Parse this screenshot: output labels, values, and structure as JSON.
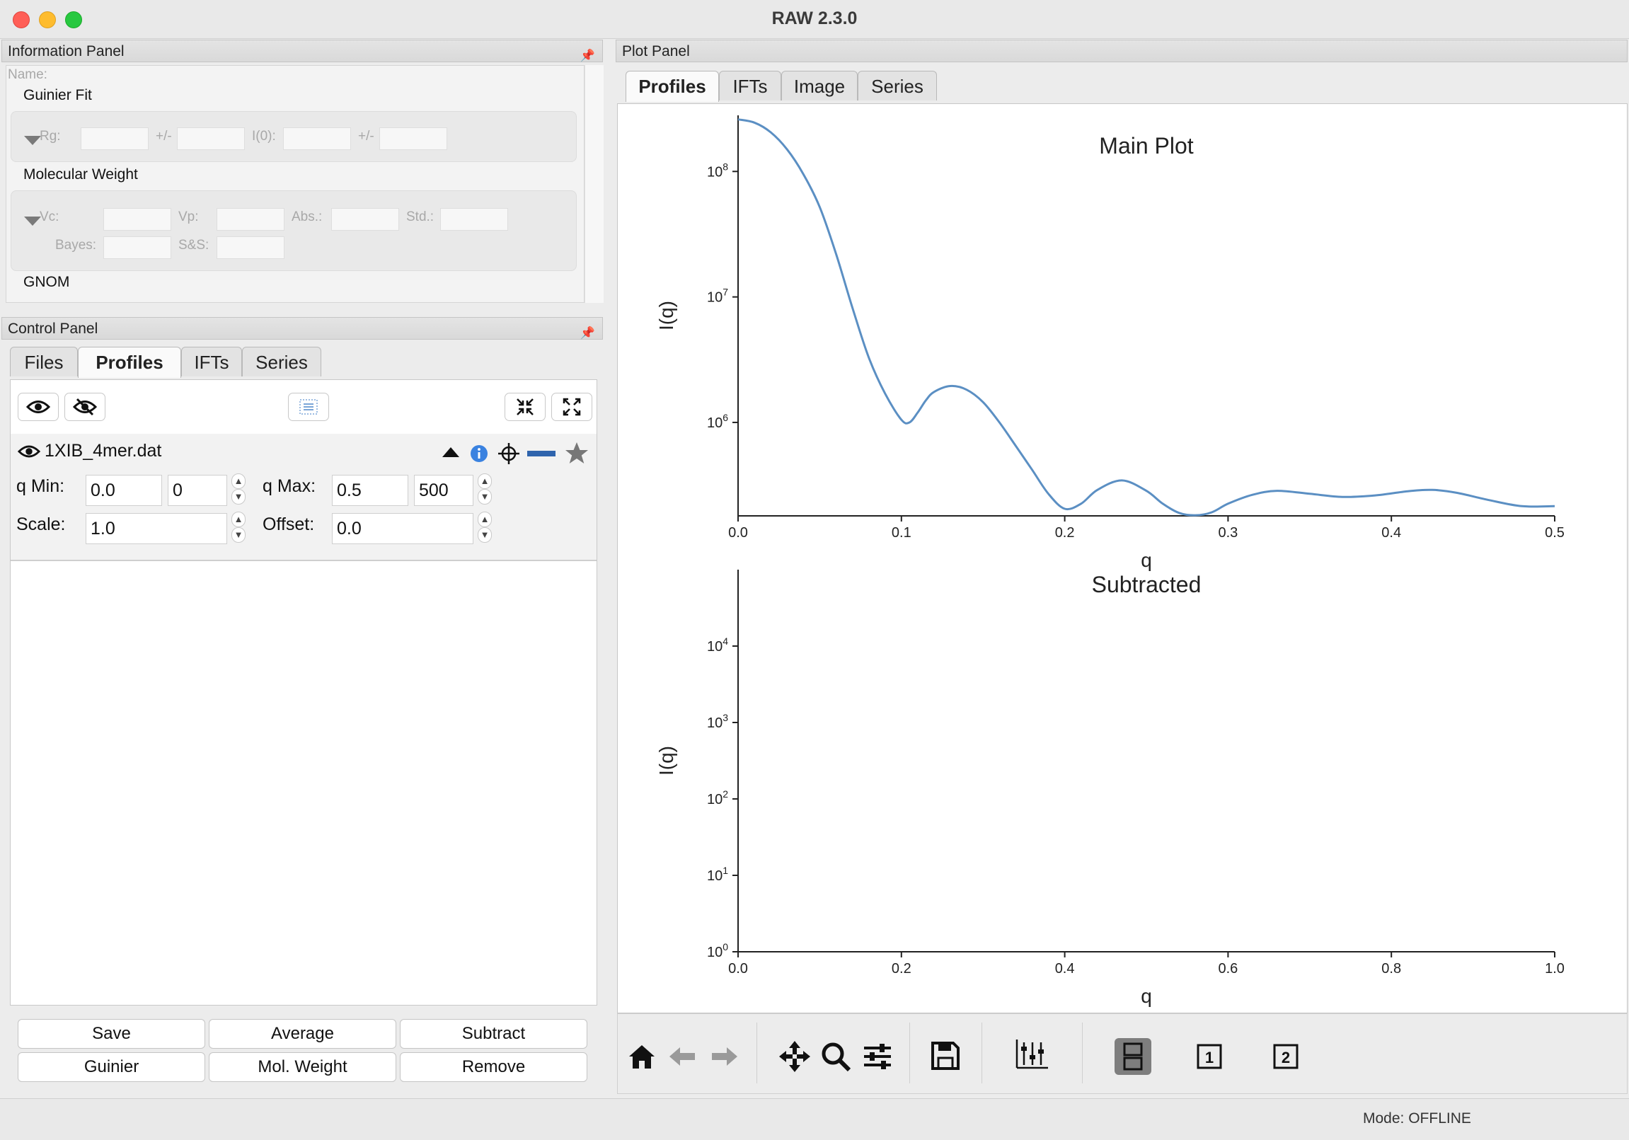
{
  "window": {
    "title": "RAW 2.3.0"
  },
  "info_panel": {
    "header": "Information Panel",
    "name_label": "Name:",
    "guinier": {
      "title": "Guinier Fit",
      "rg_label": "Rg:",
      "pm1": "+/-",
      "i0_label": "I(0):",
      "pm2": "+/-"
    },
    "mw": {
      "title": "Molecular Weight",
      "vc": "Vc:",
      "vp": "Vp:",
      "abs": "Abs.:",
      "std": "Std.:",
      "bayes": "Bayes:",
      "ss": "S&S:"
    },
    "gnom_title": "GNOM"
  },
  "control_panel": {
    "header": "Control Panel",
    "tabs": [
      "Files",
      "Profiles",
      "IFTs",
      "Series"
    ],
    "active_tab": "Profiles",
    "profile": {
      "filename": "1XIB_4mer.dat",
      "qmin_label": "q Min:",
      "qmin_value": "0.0",
      "qmin_index": "0",
      "qmax_label": "q Max:",
      "qmax_value": "0.5",
      "qmax_index": "500",
      "scale_label": "Scale:",
      "scale_value": "1.0",
      "offset_label": "Offset:",
      "offset_value": "0.0",
      "line_color": "#2f64ad"
    },
    "buttons": {
      "save": "Save",
      "average": "Average",
      "subtract": "Subtract",
      "guinier": "Guinier",
      "mol_weight": "Mol. Weight",
      "remove": "Remove"
    }
  },
  "plot_panel": {
    "header": "Plot Panel",
    "tabs": [
      "Profiles",
      "IFTs",
      "Image",
      "Series"
    ],
    "active_tab": "Profiles"
  },
  "chart_data": [
    {
      "type": "line",
      "title": "Main Plot",
      "xlabel": "q",
      "ylabel": "I(q)",
      "yscale": "log",
      "xlim": [
        0.0,
        0.5
      ],
      "ylim": [
        180000,
        280000000
      ],
      "xticks": [
        "0.0",
        "0.1",
        "0.2",
        "0.3",
        "0.4",
        "0.5"
      ],
      "yticks": [
        {
          "base": "10",
          "exp": "8",
          "value": 100000000
        },
        {
          "base": "10",
          "exp": "7",
          "value": 10000000
        },
        {
          "base": "10",
          "exp": "6",
          "value": 1000000
        }
      ],
      "color": "#5b8fc3",
      "series": [
        {
          "x": [
            0.0,
            0.01,
            0.02,
            0.03,
            0.04,
            0.05,
            0.06,
            0.07,
            0.08,
            0.09,
            0.1,
            0.105,
            0.11,
            0.115,
            0.12,
            0.13,
            0.14,
            0.15,
            0.16,
            0.17,
            0.18,
            0.19,
            0.2,
            0.21,
            0.22,
            0.235,
            0.25,
            0.26,
            0.27,
            0.28,
            0.29,
            0.3,
            0.315,
            0.33,
            0.35,
            0.37,
            0.39,
            0.41,
            0.425,
            0.44,
            0.46,
            0.48,
            0.5
          ],
          "y": [
            260000000,
            245000000,
            205000000,
            150000000,
            95000000,
            52000000,
            22000000,
            8200000,
            3300000,
            1700000,
            1050000,
            1000000,
            1200000,
            1500000,
            1750000,
            1950000,
            1820000,
            1450000,
            1000000,
            650000,
            420000,
            270000,
            205000,
            225000,
            290000,
            345000,
            285000,
            225000,
            190000,
            182000,
            192000,
            225000,
            265000,
            285000,
            270000,
            255000,
            262000,
            283000,
            290000,
            275000,
            240000,
            215000,
            215000
          ]
        }
      ]
    },
    {
      "type": "line",
      "title": "Subtracted",
      "xlabel": "q",
      "ylabel": "I(q)",
      "yscale": "log",
      "xlim": [
        0.0,
        1.0
      ],
      "ylim": [
        1,
        100000
      ],
      "xticks": [
        "0.0",
        "0.2",
        "0.4",
        "0.6",
        "0.8",
        "1.0"
      ],
      "yticks": [
        {
          "base": "10",
          "exp": "4",
          "value": 10000
        },
        {
          "base": "10",
          "exp": "3",
          "value": 1000
        },
        {
          "base": "10",
          "exp": "2",
          "value": 100
        },
        {
          "base": "10",
          "exp": "1",
          "value": 10
        },
        {
          "base": "10",
          "exp": "0",
          "value": 1
        }
      ],
      "series": []
    }
  ],
  "status": {
    "mode": "Mode: OFFLINE"
  }
}
